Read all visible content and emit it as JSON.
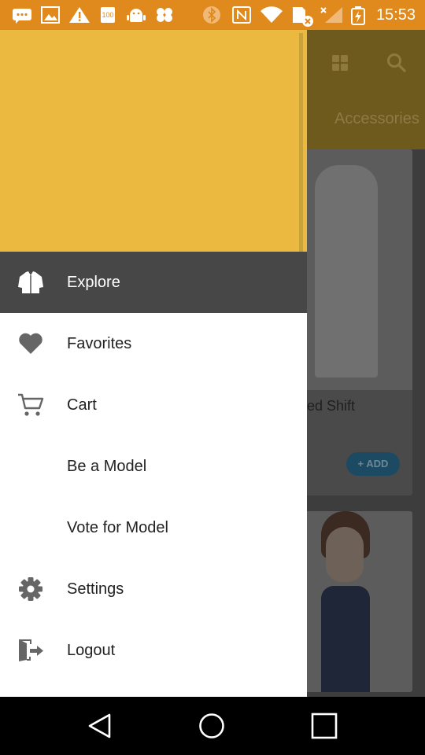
{
  "status_bar": {
    "time": "15:53",
    "icons": [
      "message-icon",
      "image-icon",
      "warning-icon",
      "battery-100-icon",
      "android-debug-icon",
      "dropbox-icon",
      "bluetooth-icon",
      "nfc-icon",
      "wifi-icon",
      "sim-blocked-icon",
      "signal-icon",
      "battery-charging-icon"
    ],
    "battery_text": "100"
  },
  "background": {
    "toolbar_icons": [
      "grid-view-icon",
      "search-icon"
    ],
    "tab_label": "Accessories",
    "product_title": "ed Shift",
    "add_label": "+ ADD"
  },
  "drawer": {
    "items": [
      {
        "label": "Explore",
        "icon": "jacket-icon",
        "active": true
      },
      {
        "label": "Favorites",
        "icon": "heart-icon",
        "active": false
      },
      {
        "label": "Cart",
        "icon": "cart-icon",
        "active": false
      },
      {
        "label": "Be a Model",
        "icon": "",
        "active": false
      },
      {
        "label": "Vote for Model",
        "icon": "",
        "active": false
      },
      {
        "label": "Settings",
        "icon": "gear-icon",
        "active": false
      },
      {
        "label": "Logout",
        "icon": "logout-icon",
        "active": false
      }
    ]
  },
  "nav_bar": {
    "buttons": [
      "back-button",
      "home-button",
      "recents-button"
    ]
  },
  "colors": {
    "status_bar": "#e08a1e",
    "drawer_header": "#ecb940",
    "active_item": "#474747",
    "icon_gray": "#666666"
  }
}
